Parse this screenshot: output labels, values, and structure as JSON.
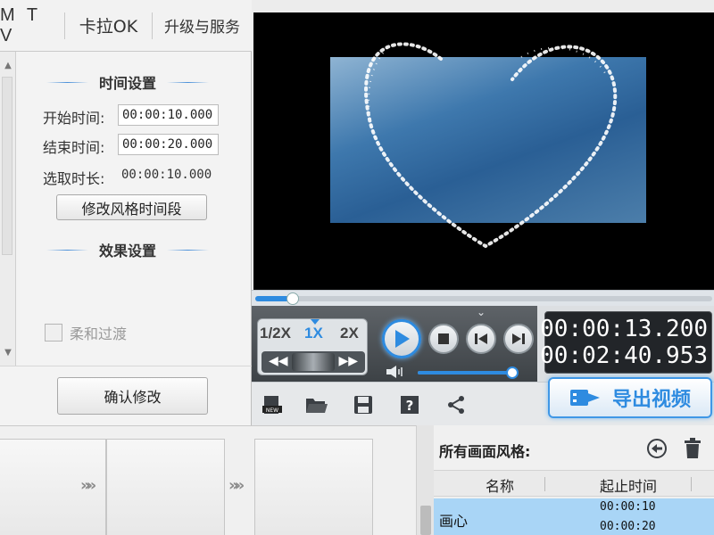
{
  "tabs": [
    "M T V",
    "卡拉OK",
    "升级与服务"
  ],
  "time_settings": {
    "title": "时间设置",
    "start_label": "开始时间:",
    "start_value": "00:00:10.000",
    "end_label": "结束时间:",
    "end_value": "00:00:20.000",
    "duration_label": "选取时长:",
    "duration_value": "00:00:10.000",
    "modify_button": "修改风格时间段"
  },
  "effect_settings": {
    "title": "效果设置",
    "smooth_label": "柔和过渡",
    "smooth_checked": false
  },
  "confirm_button": "确认修改",
  "player": {
    "progress": 0.082,
    "speeds": [
      "1/2X",
      "1X",
      "2X"
    ],
    "active_speed": "1X",
    "current_time": "00:00:13.200",
    "total_time": "00:02:40.953",
    "volume": 0.98
  },
  "toolbar": {
    "icons": [
      "new-icon",
      "open-folder-icon",
      "save-icon",
      "help-icon",
      "share-icon"
    ],
    "export_label": "导出视频",
    "accent_color": "#2e8be0"
  },
  "style_list": {
    "title": "所有画面风格:",
    "col_name": "名称",
    "col_time": "起止时间",
    "rows": [
      {
        "name": "画心",
        "start": "00:00:10",
        "end": "00:00:20"
      }
    ]
  }
}
